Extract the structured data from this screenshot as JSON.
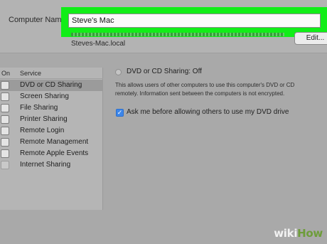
{
  "computer_name": {
    "label": "Computer Name",
    "value": "Steve's Mac",
    "local_hostname": "Steves-Mac.local",
    "edit_button": "Edit..."
  },
  "services": {
    "header_on": "On",
    "header_service": "Service",
    "items": [
      {
        "label": "DVD or CD Sharing",
        "selected": true,
        "checked": false
      },
      {
        "label": "Screen Sharing",
        "selected": false,
        "checked": false
      },
      {
        "label": "File Sharing",
        "selected": false,
        "checked": false
      },
      {
        "label": "Printer Sharing",
        "selected": false,
        "checked": false
      },
      {
        "label": "Remote Login",
        "selected": false,
        "checked": false
      },
      {
        "label": "Remote Management",
        "selected": false,
        "checked": false
      },
      {
        "label": "Remote Apple Events",
        "selected": false,
        "checked": false
      },
      {
        "label": "Internet Sharing",
        "selected": false,
        "checked": false
      }
    ]
  },
  "detail": {
    "status": "DVD or CD Sharing: Off",
    "description_line1": "This allows users of other computers to use this computer's DVD or CD",
    "description_line2": "remotely. Information sent between the computers is not encrypted.",
    "ask_label": "Ask me before allowing others to use my DVD drive",
    "ask_checked": true
  },
  "watermark": {
    "part1": "wiki",
    "part2": "How"
  },
  "colors": {
    "highlight": "#11ee18",
    "checkbox_accent": "#3d86e9",
    "background": "#a9a9a9"
  }
}
